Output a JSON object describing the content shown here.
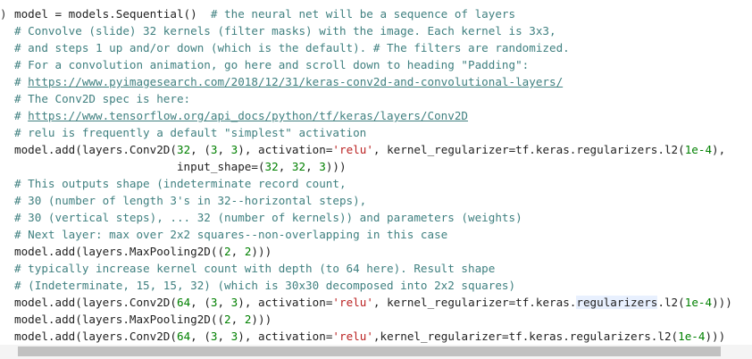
{
  "code": {
    "lines": [
      {
        "gutter": ")",
        "parts": [
          {
            "t": "model = models.Sequential()  "
          },
          {
            "t": "# the neural net will be a sequence of layers",
            "c": "cm"
          }
        ]
      },
      {
        "gutter": "",
        "parts": [
          {
            "t": "# Convolve (slide) 32 kernels (filter masks) with the image. Each kernel is 3x3,",
            "c": "cm"
          }
        ]
      },
      {
        "gutter": "",
        "parts": [
          {
            "t": "# and steps 1 up and/or down (which is the default). # The filters are randomized.",
            "c": "cm"
          }
        ]
      },
      {
        "gutter": "",
        "parts": [
          {
            "t": "# For a convolution animation, go here and scroll down to heading \"Padding\":",
            "c": "cm"
          }
        ]
      },
      {
        "gutter": "",
        "parts": [
          {
            "t": "# ",
            "c": "cm"
          },
          {
            "t": "https://www.pyimagesearch.com/2018/12/31/keras-conv2d-and-convolutional-layers/",
            "c": "url",
            "link": true
          }
        ]
      },
      {
        "gutter": "",
        "parts": [
          {
            "t": "# The Conv2D spec is here:",
            "c": "cm"
          }
        ]
      },
      {
        "gutter": "",
        "parts": [
          {
            "t": "# ",
            "c": "cm"
          },
          {
            "t": "https://www.tensorflow.org/api_docs/python/tf/keras/layers/Conv2D",
            "c": "url",
            "link": true
          }
        ]
      },
      {
        "gutter": "",
        "parts": [
          {
            "t": "# relu is frequently a default \"simplest\" activation",
            "c": "cm"
          }
        ]
      },
      {
        "gutter": "",
        "parts": [
          {
            "t": "model.add(layers.Conv2D("
          },
          {
            "t": "32",
            "c": "num"
          },
          {
            "t": ", ("
          },
          {
            "t": "3",
            "c": "num"
          },
          {
            "t": ", "
          },
          {
            "t": "3",
            "c": "num"
          },
          {
            "t": "), activation="
          },
          {
            "t": "'relu'",
            "c": "str"
          },
          {
            "t": ", kernel_regularizer=tf.keras.regularizers.l2("
          },
          {
            "t": "1e-4",
            "c": "num"
          },
          {
            "t": "),"
          }
        ]
      },
      {
        "gutter": "",
        "parts": [
          {
            "t": "                        input_shape=("
          },
          {
            "t": "32",
            "c": "num"
          },
          {
            "t": ", "
          },
          {
            "t": "32",
            "c": "num"
          },
          {
            "t": ", "
          },
          {
            "t": "3",
            "c": "num"
          },
          {
            "t": ")))"
          }
        ]
      },
      {
        "gutter": "",
        "parts": [
          {
            "t": "# This outputs shape (indeterminate record count,",
            "c": "cm"
          }
        ]
      },
      {
        "gutter": "",
        "parts": [
          {
            "t": "# 30 (number of length 3's in 32--horizontal steps),",
            "c": "cm"
          }
        ]
      },
      {
        "gutter": "",
        "parts": [
          {
            "t": "# 30 (vertical steps), ... 32 (number of kernels)) and parameters (weights)",
            "c": "cm"
          }
        ]
      },
      {
        "gutter": "",
        "parts": [
          {
            "t": "# Next layer: max over 2x2 squares--non-overlapping in this case",
            "c": "cm"
          }
        ]
      },
      {
        "gutter": "",
        "parts": [
          {
            "t": "model.add(layers.MaxPooling2D(("
          },
          {
            "t": "2",
            "c": "num"
          },
          {
            "t": ", "
          },
          {
            "t": "2",
            "c": "num"
          },
          {
            "t": ")))"
          }
        ]
      },
      {
        "gutter": "",
        "parts": [
          {
            "t": "# typically increase kernel count with depth (to 64 here). Result shape",
            "c": "cm"
          }
        ]
      },
      {
        "gutter": "",
        "parts": [
          {
            "t": "# (Indeterminate, 15, 15, 32) (which is 30x30 decomposed into 2x2 squares)",
            "c": "cm"
          }
        ]
      },
      {
        "gutter": "",
        "parts": [
          {
            "t": "model.add(layers.Conv2D("
          },
          {
            "t": "64",
            "c": "num"
          },
          {
            "t": ", ("
          },
          {
            "t": "3",
            "c": "num"
          },
          {
            "t": ", "
          },
          {
            "t": "3",
            "c": "num"
          },
          {
            "t": "), activation="
          },
          {
            "t": "'relu'",
            "c": "str"
          },
          {
            "t": ", kernel_regularizer=tf.keras."
          },
          {
            "t": "regularizers",
            "c": "hl"
          },
          {
            "t": ".l2("
          },
          {
            "t": "1e-4",
            "c": "num"
          },
          {
            "t": ")))"
          }
        ]
      },
      {
        "gutter": "",
        "parts": [
          {
            "t": "model.add(layers.MaxPooling2D(("
          },
          {
            "t": "2",
            "c": "num"
          },
          {
            "t": ", "
          },
          {
            "t": "2",
            "c": "num"
          },
          {
            "t": ")))"
          }
        ]
      },
      {
        "gutter": "",
        "parts": [
          {
            "t": "model.add(layers.Conv2D("
          },
          {
            "t": "64",
            "c": "num"
          },
          {
            "t": ", ("
          },
          {
            "t": "3",
            "c": "num"
          },
          {
            "t": ", "
          },
          {
            "t": "3",
            "c": "num"
          },
          {
            "t": "), activation="
          },
          {
            "t": "'relu'",
            "c": "str"
          },
          {
            "t": ",kernel_regularizer=tf.keras.regularizers.l2("
          },
          {
            "t": "1e-4",
            "c": "num"
          },
          {
            "t": ")))"
          }
        ]
      }
    ]
  },
  "colors": {
    "comment": "#408080",
    "string": "#ba2121",
    "number": "#008000",
    "text": "#212121",
    "scrollbar_thumb": "#c1c1c1",
    "scrollbar_track": "#f4f4f4"
  }
}
